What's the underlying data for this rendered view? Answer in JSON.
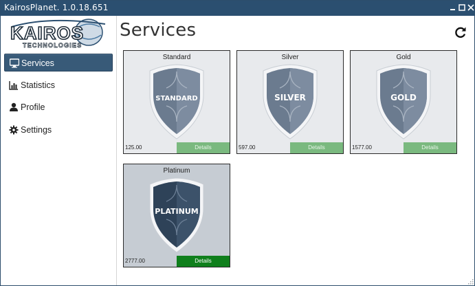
{
  "window": {
    "title": "KairosPlanet. 1.0.18.651"
  },
  "logo": {
    "text": "KAIROS",
    "subtext": "TECHNOLOGIES"
  },
  "sidebar": {
    "items": [
      {
        "label": "Services",
        "icon": "monitor-icon",
        "active": true
      },
      {
        "label": "Statistics",
        "icon": "bar-chart-icon",
        "active": false
      },
      {
        "label": "Profile",
        "icon": "user-icon",
        "active": false
      },
      {
        "label": "Settings",
        "icon": "gear-icon",
        "active": false
      }
    ]
  },
  "main": {
    "title": "Services",
    "refresh_icon": "refresh-icon",
    "cards": [
      {
        "name": "Standard",
        "badge": "STANDARD",
        "price": "125.00",
        "details_label": "Details",
        "selected": false
      },
      {
        "name": "Silver",
        "badge": "SILVER",
        "price": "597.00",
        "details_label": "Details",
        "selected": false
      },
      {
        "name": "Gold",
        "badge": "GOLD",
        "price": "1577.00",
        "details_label": "Details",
        "selected": false
      },
      {
        "name": "Platinum",
        "badge": "PLATINUM",
        "price": "2777.00",
        "details_label": "Details",
        "selected": true
      }
    ]
  },
  "colors": {
    "titlebar": "#2b4f70",
    "sidebar_active": "#385a78",
    "details_disabled": "#7ab97f",
    "details_active": "#0f7f1c",
    "card_bg": "#e8eaed",
    "card_selected_bg": "#c6ccd3"
  }
}
